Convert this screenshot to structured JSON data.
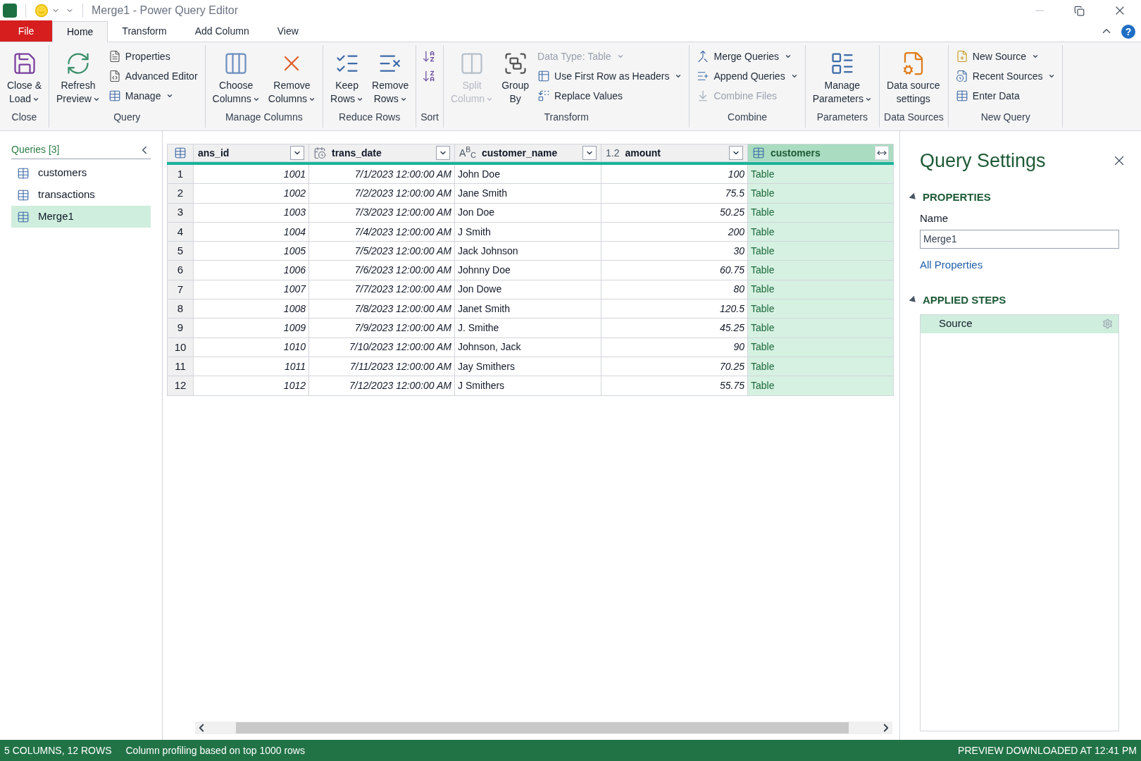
{
  "window": {
    "title": "Merge1 - Power Query Editor"
  },
  "tabs": [
    {
      "label": "File",
      "kind": "file",
      "selected": false
    },
    {
      "label": "Home",
      "kind": "tab",
      "selected": true
    },
    {
      "label": "Transform",
      "kind": "tab",
      "selected": false
    },
    {
      "label": "Add Column",
      "kind": "tab",
      "selected": false
    },
    {
      "label": "View",
      "kind": "tab",
      "selected": false
    }
  ],
  "help": "?",
  "ribbon": {
    "groups": [
      {
        "label": "Close",
        "buttons": [
          {
            "label": "Close &\nLoad",
            "kind": "large",
            "dropdown": true,
            "disabled": false
          }
        ]
      },
      {
        "label": "Query",
        "buttons": [
          {
            "label": "Refresh\nPreview",
            "kind": "large",
            "dropdown": true,
            "disabled": false
          },
          {
            "label": "Properties",
            "kind": "small",
            "dropdown": false,
            "disabled": false
          },
          {
            "label": "Advanced Editor",
            "kind": "small",
            "dropdown": false,
            "disabled": false
          },
          {
            "label": "Manage",
            "kind": "small",
            "dropdown": true,
            "disabled": false
          }
        ]
      },
      {
        "label": "Manage Columns",
        "buttons": [
          {
            "label": "Choose\nColumns",
            "kind": "large",
            "dropdown": true,
            "disabled": false
          },
          {
            "label": "Remove\nColumns",
            "kind": "large",
            "dropdown": true,
            "disabled": false
          }
        ]
      },
      {
        "label": "Reduce Rows",
        "buttons": [
          {
            "label": "Keep\nRows",
            "kind": "large",
            "dropdown": true,
            "disabled": false
          },
          {
            "label": "Remove\nRows",
            "kind": "large",
            "dropdown": true,
            "disabled": false
          }
        ]
      },
      {
        "label": "Sort",
        "buttons": [
          {
            "kind": "icon",
            "disabled": false
          },
          {
            "kind": "icon",
            "disabled": false
          }
        ]
      },
      {
        "label": "Transform",
        "buttons": [
          {
            "label": "Split\nColumn",
            "kind": "large",
            "dropdown": true,
            "disabled": true
          },
          {
            "label": "Group\nBy",
            "kind": "large",
            "dropdown": false,
            "disabled": false
          },
          {
            "label": "Data Type: Table",
            "kind": "small",
            "dropdown": true,
            "disabled": true
          },
          {
            "label": "Use First Row as Headers",
            "kind": "small",
            "dropdown": true,
            "disabled": false
          },
          {
            "label": "Replace Values",
            "kind": "small",
            "dropdown": false,
            "disabled": false
          }
        ]
      },
      {
        "label": "Combine",
        "buttons": [
          {
            "label": "Merge Queries",
            "kind": "small",
            "dropdown": true,
            "disabled": false
          },
          {
            "label": "Append Queries",
            "kind": "small",
            "dropdown": true,
            "disabled": false
          },
          {
            "label": "Combine Files",
            "kind": "small",
            "dropdown": false,
            "disabled": true
          }
        ]
      },
      {
        "label": "Parameters",
        "buttons": [
          {
            "label": "Manage\nParameters",
            "kind": "large",
            "dropdown": true,
            "disabled": false
          }
        ]
      },
      {
        "label": "Data Sources",
        "buttons": [
          {
            "label": "Data source\nsettings",
            "kind": "large",
            "dropdown": false,
            "disabled": false
          }
        ]
      },
      {
        "label": "New Query",
        "buttons": [
          {
            "label": "New Source",
            "kind": "small",
            "dropdown": true,
            "disabled": false
          },
          {
            "label": "Recent Sources",
            "kind": "small",
            "dropdown": true,
            "disabled": false
          },
          {
            "label": "Enter Data",
            "kind": "small",
            "dropdown": false,
            "disabled": false
          }
        ]
      }
    ]
  },
  "queries": {
    "title": "Queries [3]",
    "items": [
      {
        "name": "customers",
        "selected": false
      },
      {
        "name": "transactions",
        "selected": false
      },
      {
        "name": "Merge1",
        "selected": true
      }
    ]
  },
  "table": {
    "columns": [
      {
        "name": "ans_id",
        "kind": "none",
        "selected": false
      },
      {
        "name": "trans_date",
        "kind": "datetime",
        "selected": false
      },
      {
        "name": "customer_name",
        "kind": "text",
        "type_label": "A$^{B}$$_{C}$",
        "selected": false
      },
      {
        "name": "amount",
        "kind": "decimal",
        "type_label": "1.2",
        "selected": false
      },
      {
        "name": "customers",
        "kind": "table",
        "selected": true
      }
    ],
    "rows": [
      {
        "number": "1",
        "cells": [
          "1001",
          "7/1/2023 12:00:00 AM",
          "John Doe",
          "100",
          "Table"
        ]
      },
      {
        "number": "2",
        "cells": [
          "1002",
          "7/2/2023 12:00:00 AM",
          "Jane Smith",
          "75.5",
          "Table"
        ]
      },
      {
        "number": "3",
        "cells": [
          "1003",
          "7/3/2023 12:00:00 AM",
          "Jon Doe",
          "50.25",
          "Table"
        ]
      },
      {
        "number": "4",
        "cells": [
          "1004",
          "7/4/2023 12:00:00 AM",
          "J Smith",
          "200",
          "Table"
        ]
      },
      {
        "number": "5",
        "cells": [
          "1005",
          "7/5/2023 12:00:00 AM",
          "Jack Johnson",
          "30",
          "Table"
        ]
      },
      {
        "number": "6",
        "cells": [
          "1006",
          "7/6/2023 12:00:00 AM",
          "Johnny Doe",
          "60.75",
          "Table"
        ]
      },
      {
        "number": "7",
        "cells": [
          "1007",
          "7/7/2023 12:00:00 AM",
          "Jon Dowe",
          "80",
          "Table"
        ]
      },
      {
        "number": "8",
        "cells": [
          "1008",
          "7/8/2023 12:00:00 AM",
          "Janet Smith",
          "120.5",
          "Table"
        ]
      },
      {
        "number": "9",
        "cells": [
          "1009",
          "7/9/2023 12:00:00 AM",
          "J. Smithe",
          "45.25",
          "Table"
        ]
      },
      {
        "number": "10",
        "cells": [
          "1010",
          "7/10/2023 12:00:00 AM",
          "Johnson, Jack",
          "90",
          "Table"
        ]
      },
      {
        "number": "11",
        "cells": [
          "1011",
          "7/11/2023 12:00:00 AM",
          "Jay Smithers",
          "70.25",
          "Table"
        ]
      },
      {
        "number": "12",
        "cells": [
          "1012",
          "7/12/2023 12:00:00 AM",
          "J Smithers",
          "55.75",
          "Table"
        ]
      }
    ]
  },
  "query_settings": {
    "title": "Query Settings",
    "properties": {
      "heading": "PROPERTIES",
      "expanded": true,
      "name_label": "Name",
      "name_value": "Merge1",
      "link": "All Properties"
    },
    "applied_steps": {
      "heading": "APPLIED STEPS",
      "expanded": true,
      "steps": [
        {
          "name": "Source",
          "selected": true
        }
      ]
    }
  },
  "status_bar": {
    "left": [
      "5 COLUMNS, 12 ROWS",
      "Column profiling based on top 1000 rows"
    ],
    "right": "PREVIEW DOWNLOADED AT 12:41 PM"
  }
}
